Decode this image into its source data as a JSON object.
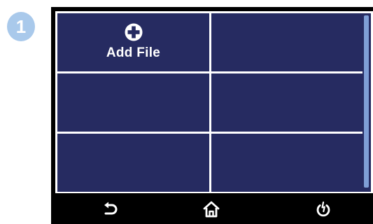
{
  "step": {
    "number": "1",
    "color": "#a9c9eb"
  },
  "screen": {
    "cells": [
      {
        "label": "Add File",
        "icon": "plus-circle-icon"
      },
      {
        "label": ""
      },
      {
        "label": ""
      },
      {
        "label": ""
      },
      {
        "label": ""
      },
      {
        "label": ""
      }
    ],
    "cell_color": "#262b61",
    "scrollbar_color": "#7f9fd6"
  },
  "toolbar": {
    "buttons": [
      {
        "icon": "back-arrow-icon"
      },
      {
        "icon": "home-icon"
      },
      {
        "icon": "power-icon"
      }
    ]
  }
}
